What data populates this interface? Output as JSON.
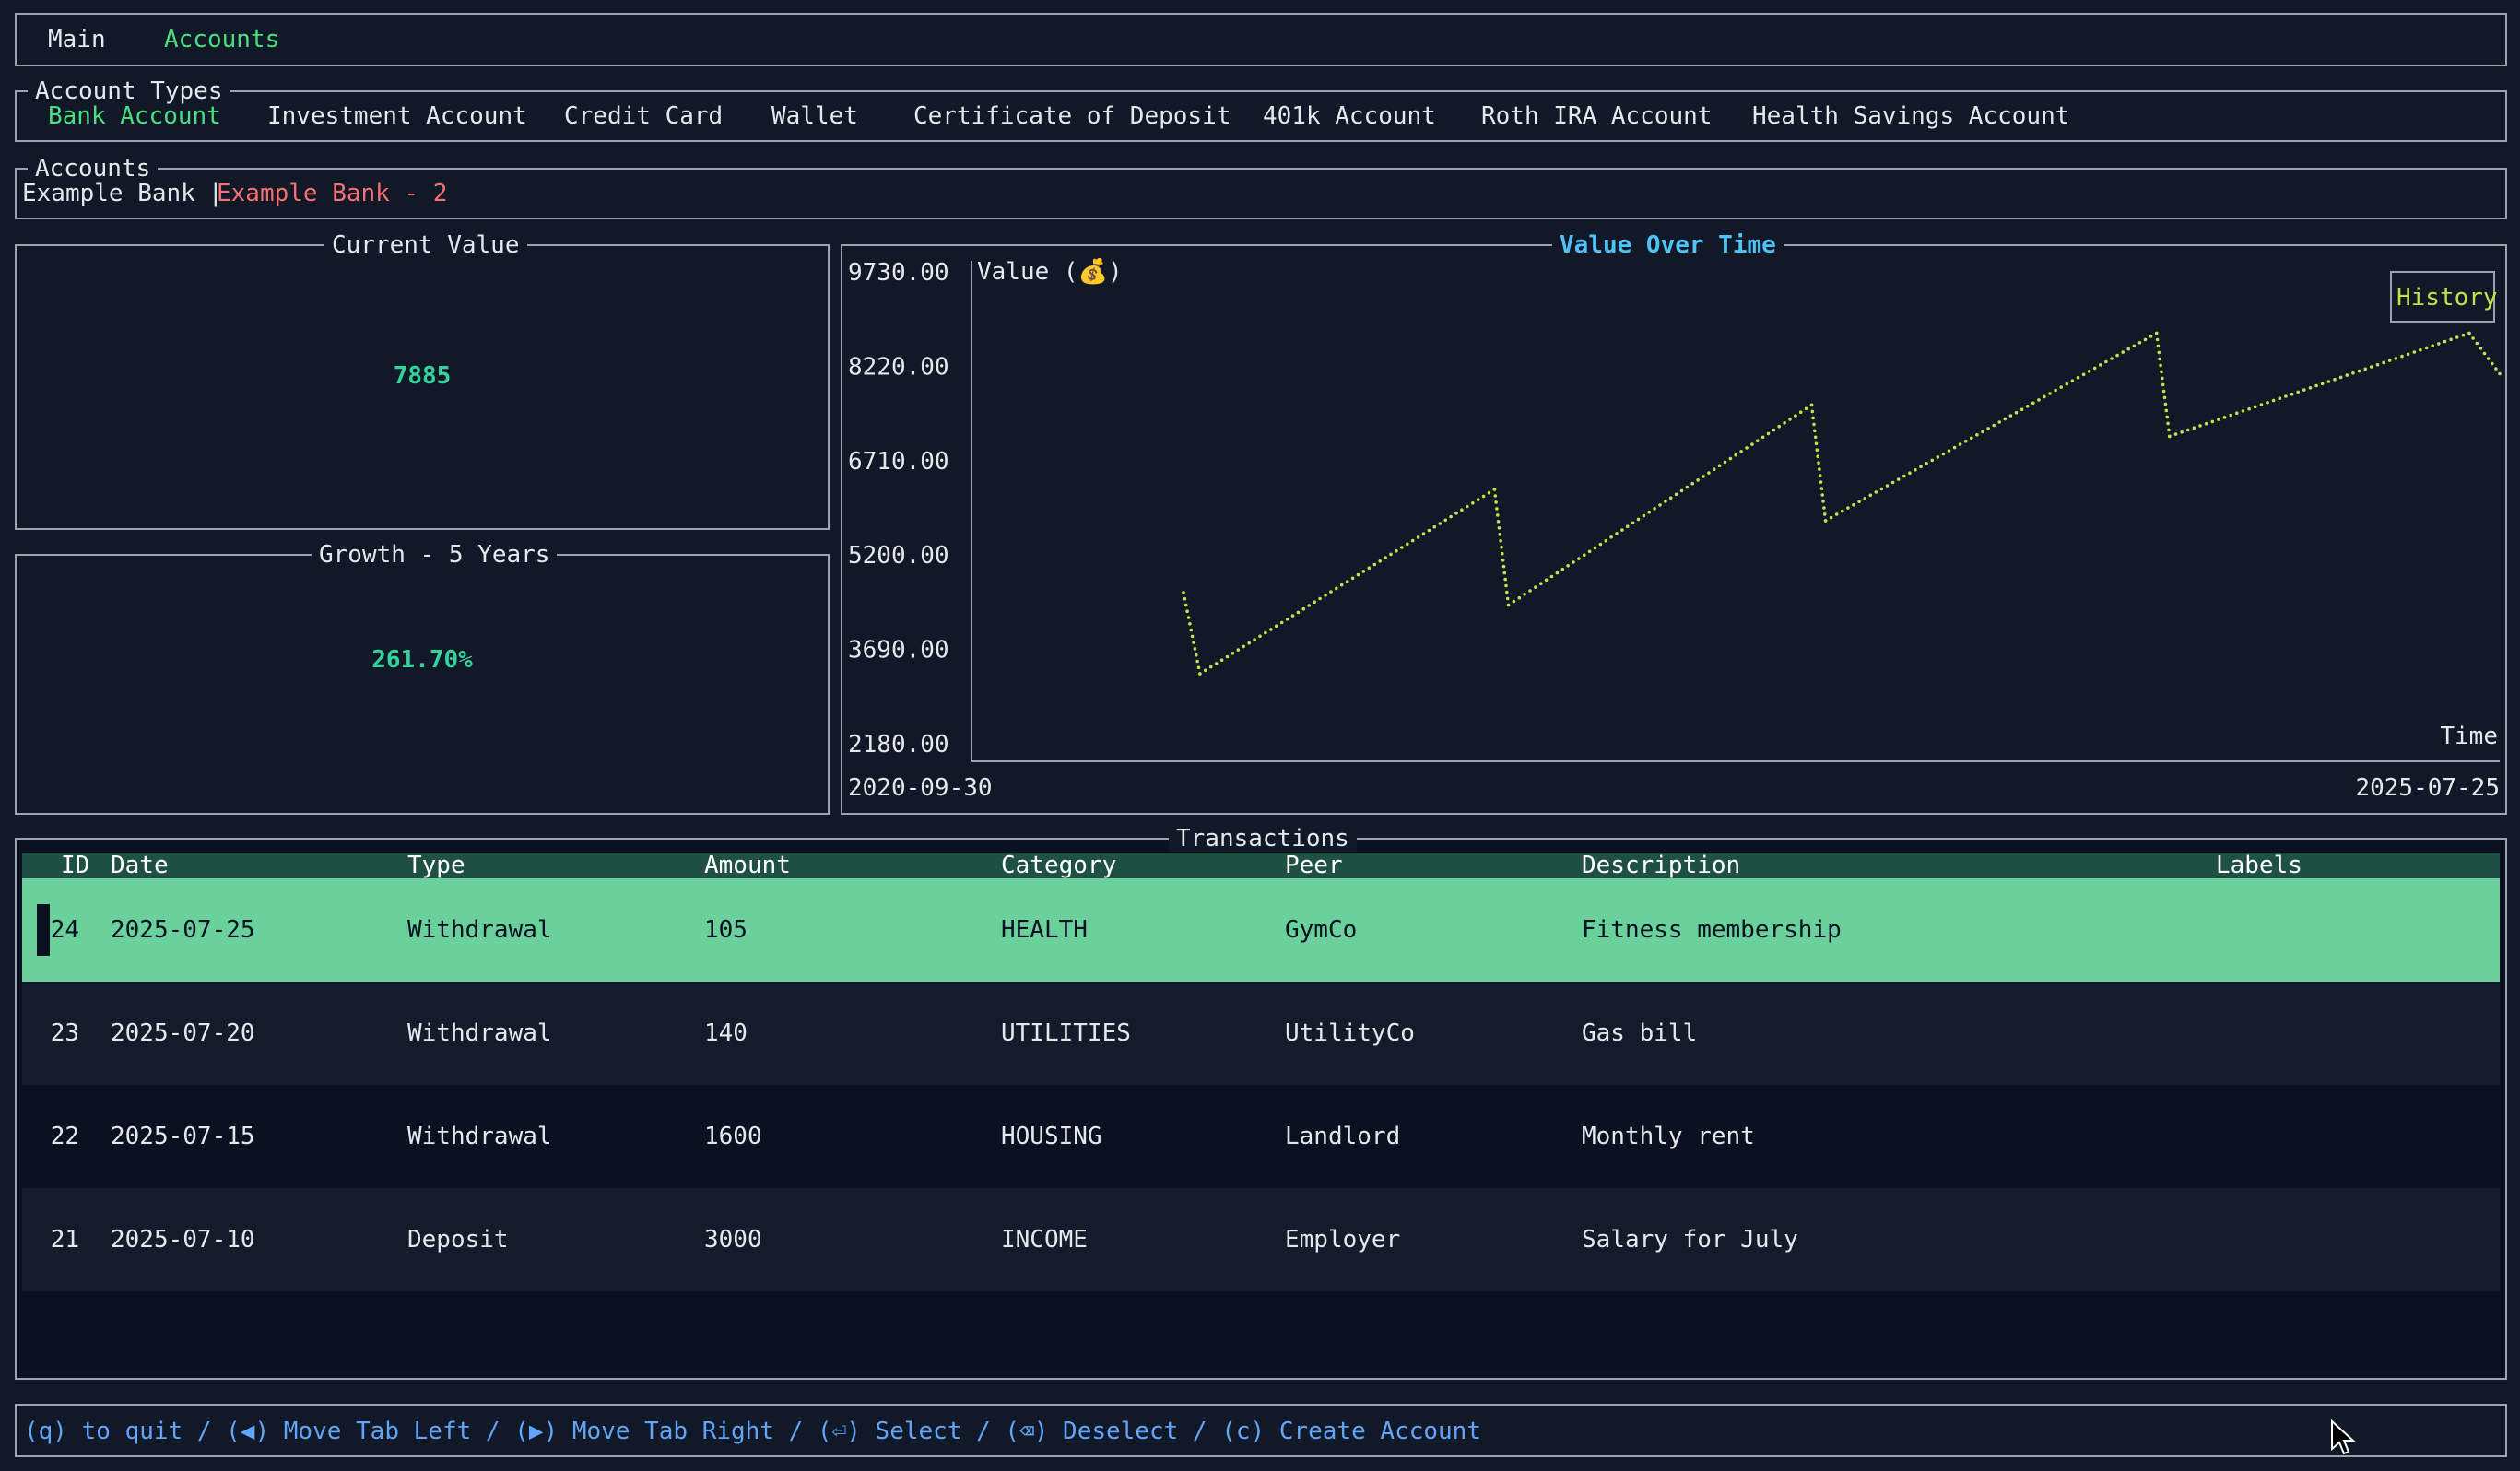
{
  "tabs": {
    "main": "Main",
    "accounts": "Accounts"
  },
  "account_types": {
    "title": "Account Types",
    "items": [
      "Bank Account",
      "Investment Account",
      "Credit Card",
      "Wallet",
      "Certificate of Deposit",
      "401k Account",
      "Roth IRA Account",
      "Health Savings Account"
    ],
    "selected": "Bank Account"
  },
  "accounts": {
    "title": "Accounts",
    "items": [
      "Example Bank",
      "Example Bank - 2"
    ],
    "separator": "|",
    "selected": "Example Bank - 2"
  },
  "current_value": {
    "title": "Current Value",
    "value": "7885"
  },
  "growth": {
    "title": "Growth - 5 Years",
    "value": "261.70%"
  },
  "chart": {
    "title": "Value Over Time",
    "legend_label": "History",
    "y_axis_title": "Value (💰)",
    "x_axis_title": "Time",
    "y_ticks": [
      "9730.00",
      "8220.00",
      "6710.00",
      "5200.00",
      "3690.00",
      "2180.00"
    ],
    "x_start": "2020-09-30",
    "x_end": "2025-07-25"
  },
  "chart_data": {
    "type": "line",
    "title": "Value Over Time",
    "xlabel": "Time",
    "ylabel": "Value (💰)",
    "ylim": [
      2180,
      9730
    ],
    "x": [
      "2020-09-30",
      "2021-06-01",
      "2021-06-20",
      "2022-05-25",
      "2022-06-10",
      "2023-06-01",
      "2023-06-20",
      "2024-06-25",
      "2024-07-10",
      "2025-06-15",
      "2025-07-25"
    ],
    "series": [
      {
        "name": "History",
        "color": "#c6e04a",
        "points": [
          [
            "2021-06-01",
            4600
          ],
          [
            "2021-06-20",
            3300
          ],
          [
            "2022-05-25",
            6250
          ],
          [
            "2022-06-10",
            4400
          ],
          [
            "2023-05-25",
            7600
          ],
          [
            "2023-06-10",
            5750
          ],
          [
            "2024-06-25",
            8750
          ],
          [
            "2024-07-10",
            7100
          ],
          [
            "2025-06-20",
            8750
          ],
          [
            "2025-07-25",
            8100
          ]
        ]
      }
    ]
  },
  "transactions": {
    "title": "Transactions",
    "columns": [
      "ID",
      "Date",
      "Type",
      "Amount",
      "Category",
      "Peer",
      "Description",
      "Labels"
    ],
    "rows": [
      {
        "id": "24",
        "date": "2025-07-25",
        "type": "Withdrawal",
        "amount": "105",
        "category": "HEALTH",
        "peer": "GymCo",
        "description": "Fitness membership",
        "labels": ""
      },
      {
        "id": "23",
        "date": "2025-07-20",
        "type": "Withdrawal",
        "amount": "140",
        "category": "UTILITIES",
        "peer": "UtilityCo",
        "description": "Gas bill",
        "labels": ""
      },
      {
        "id": "22",
        "date": "2025-07-15",
        "type": "Withdrawal",
        "amount": "1600",
        "category": "HOUSING",
        "peer": "Landlord",
        "description": "Monthly rent",
        "labels": ""
      },
      {
        "id": "21",
        "date": "2025-07-10",
        "type": "Deposit",
        "amount": "3000",
        "category": "INCOME",
        "peer": "Employer",
        "description": "Salary for July",
        "labels": ""
      }
    ]
  },
  "footer": {
    "text": "(q) to quit / (◀) Move Tab Left / (▶) Move Tab Right / (⏎) Select / (⌫) Deselect / (c) Create Account"
  },
  "colors": {
    "background": "#111827",
    "accent_green": "#4ade80",
    "value_green": "#34d399",
    "selected_row": "#6ad19d",
    "chart_title": "#4fc3f7",
    "series": "#c6e04a",
    "footer_text": "#60a5fa",
    "selected_account": "#f87171"
  }
}
